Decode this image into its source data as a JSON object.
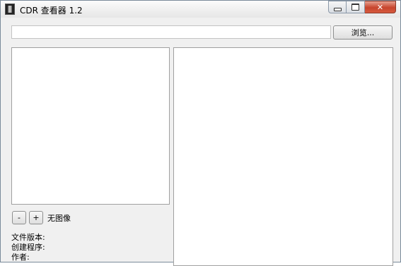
{
  "window": {
    "title": "CDR 查看器 1.2",
    "controls": {
      "minimize": "minimize",
      "maximize": "maximize",
      "close": "✕"
    }
  },
  "toolbar": {
    "path_value": "",
    "browse_label": "浏览..."
  },
  "preview": {
    "zoom_out_label": "-",
    "zoom_in_label": "+",
    "status_text": "无图像"
  },
  "file_info": {
    "version_label": "文件版本:",
    "creator_label": "创建程序:",
    "author_label": "作者:"
  }
}
